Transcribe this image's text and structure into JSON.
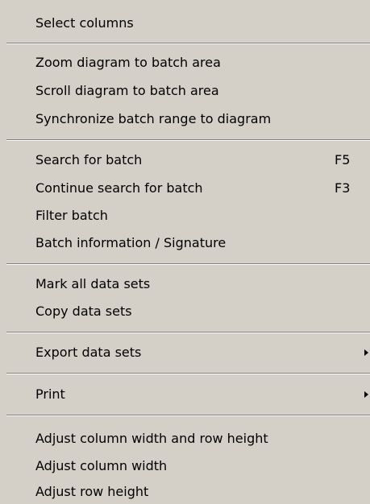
{
  "menu": {
    "select_columns": "Select columns",
    "zoom_diagram": "Zoom diagram to batch area",
    "scroll_diagram": "Scroll diagram to batch area",
    "synchronize_batch": "Synchronize batch range to diagram",
    "search_batch": "Search for batch",
    "search_batch_shortcut": "F5",
    "continue_search": "Continue search for batch",
    "continue_search_shortcut": "F3",
    "filter_batch": "Filter batch",
    "batch_information": "Batch information / Signature",
    "mark_all": "Mark all data sets",
    "copy_data_sets": "Copy data sets",
    "export_data_sets": "Export data sets",
    "print": "Print",
    "adjust_column_row": "Adjust column width and row height",
    "adjust_column": "Adjust column width",
    "adjust_row": "Adjust row height"
  },
  "icons": {
    "submenu": "submenu-arrow-icon"
  },
  "colors": {
    "background": "#d4d0c8",
    "separator_dark": "#808080",
    "separator_light": "#ffffff",
    "text": "#000000"
  }
}
